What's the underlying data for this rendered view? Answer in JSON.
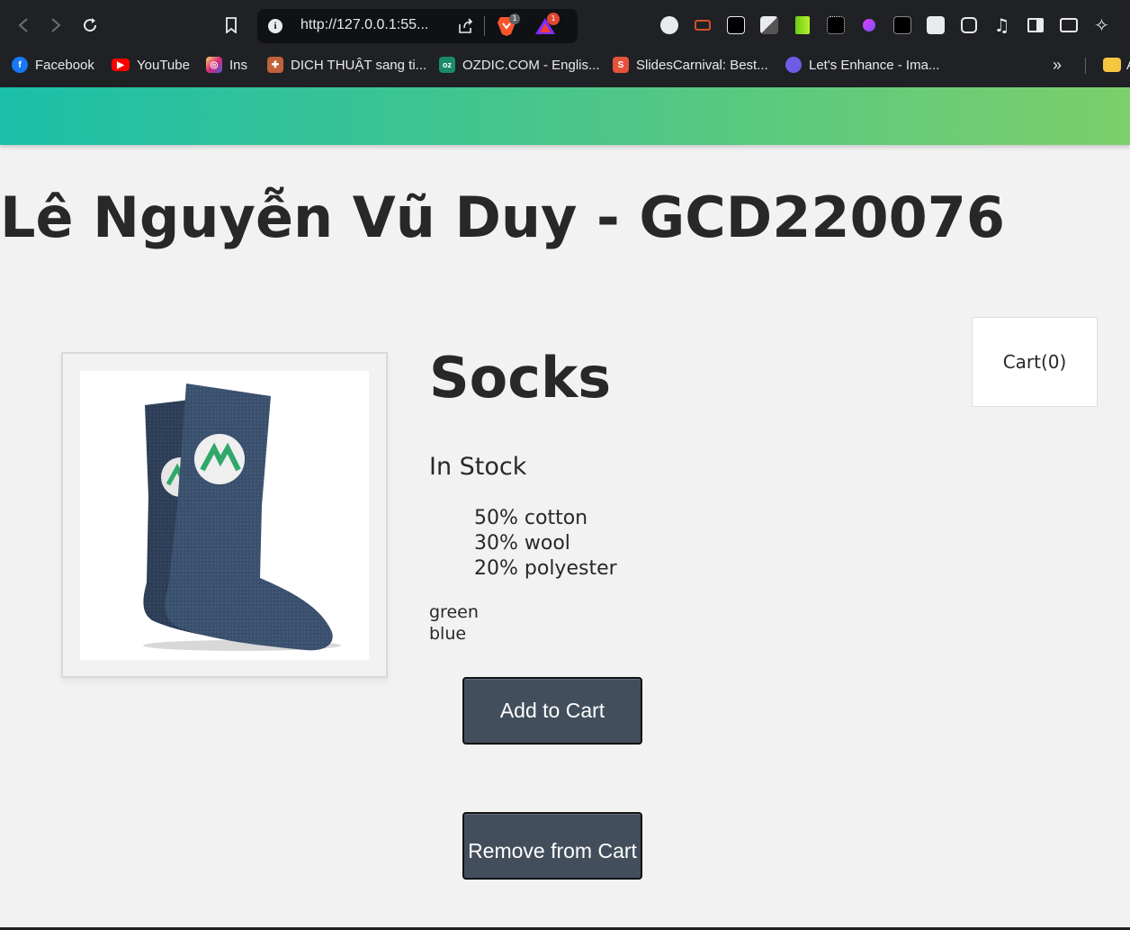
{
  "browser": {
    "url": "http://127.0.0.1:55...",
    "brave_badge": "1",
    "alert_badge": "1",
    "bookmarks": [
      {
        "label": "Facebook",
        "color": "#1877f2"
      },
      {
        "label": "YouTube",
        "color": "#ff0000"
      },
      {
        "label": "Ins",
        "color": "#d62976"
      },
      {
        "label": "DICH THUẬT sang ti...",
        "color": "#c0623c"
      },
      {
        "label": "OZDIC.COM - Englis...",
        "color": "#1a8a6a"
      },
      {
        "label": "SlidesCarnival: Best...",
        "color": "#e5533d"
      },
      {
        "label": "Let's Enhance - Ima...",
        "color": "#6c5ce7"
      }
    ],
    "overflow_label": "»",
    "folder_label": "A"
  },
  "page": {
    "heading": "Lê Nguyễn Vũ Duy - GCD220076",
    "cart_label": "Cart(0)",
    "product": {
      "name": "Socks",
      "stock_status": "In Stock",
      "details": [
        "50% cotton",
        "30% wool",
        "20% polyester"
      ],
      "variants": [
        "green",
        "blue"
      ],
      "image_alt": "socks-product-image"
    },
    "buttons": {
      "add_to_cart": "Add to Cart",
      "remove_from_cart": "Remove from Cart"
    }
  },
  "colors": {
    "banner_start": "#1cbfa9",
    "banner_end": "#7ccf6b",
    "button_bg": "#434e5c",
    "page_bg": "#f2f2f2"
  }
}
